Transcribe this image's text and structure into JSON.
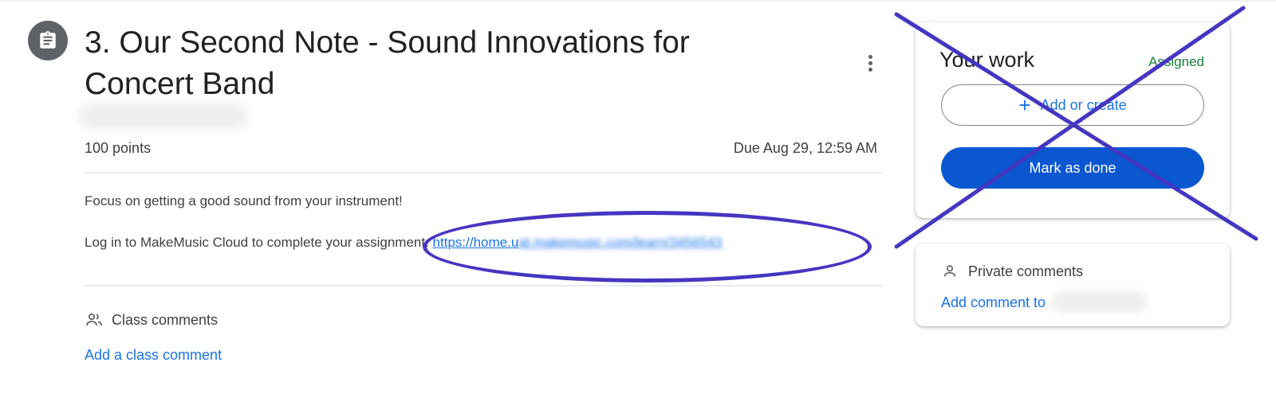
{
  "assignment": {
    "title": "3. Our Second Note - Sound Innovations for Concert Band",
    "points": "100 points",
    "due": "Due Aug 29, 12:59 AM",
    "description_line1": "Focus on getting a good sound from your instrument!",
    "description_line2_prefix": "Log in to MakeMusic Cloud to complete your assignment: ",
    "link_visible": "https://home.u",
    "link_blurred": "at.makemusic.com/learn/3456543",
    "icon": "assignment-icon"
  },
  "class_comments": {
    "label": "Class comments",
    "add_label": "Add a class comment",
    "icon": "people-icon"
  },
  "your_work": {
    "title": "Your work",
    "status": "Assigned",
    "add_create_label": "Add or create",
    "mark_done_label": "Mark as done"
  },
  "private_comments": {
    "label": "Private comments",
    "add_label": "Add comment to",
    "icon": "person-icon"
  },
  "colors": {
    "accent_blue": "#1a73e8",
    "primary_button": "#0b57d0",
    "status_green": "#188038",
    "annotation_purple": "#4536c1"
  }
}
